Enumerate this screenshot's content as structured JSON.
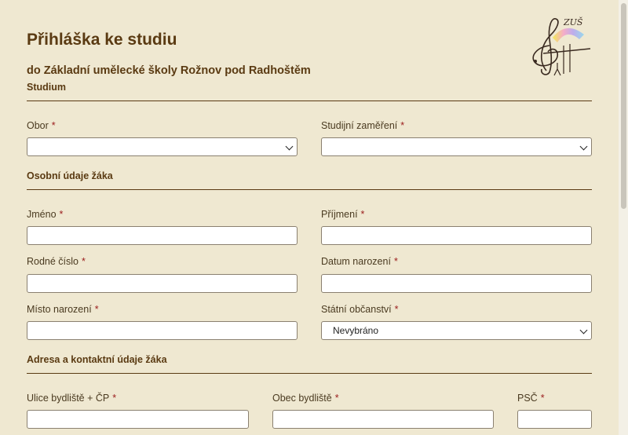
{
  "header": {
    "title": "Přihláška ke studiu",
    "subtitle": "do Základní umělecké školy Rožnov pod Radhoštěm",
    "logo_text": "ZUŠ"
  },
  "sections": {
    "studium": "Studium",
    "osobni": "Osobní údaje žáka",
    "adresa": "Adresa a kontaktní údaje žáka"
  },
  "fields": {
    "obor": {
      "label": "Obor",
      "required": "*",
      "value": ""
    },
    "zamereni": {
      "label": "Studijní zaměření",
      "required": "*",
      "value": ""
    },
    "jmeno": {
      "label": "Jméno",
      "required": "*"
    },
    "prijmeni": {
      "label": "Příjmení",
      "required": "*"
    },
    "rodne_cislo": {
      "label": "Rodné číslo",
      "required": "*"
    },
    "datum_narozeni": {
      "label": "Datum narození",
      "required": "*"
    },
    "misto_narozeni": {
      "label": "Místo narození",
      "required": "*"
    },
    "obcanstvi": {
      "label": "Státní občanství",
      "required": "*",
      "value": "Nevybráno"
    },
    "ulice": {
      "label": "Ulice bydliště + ČP",
      "required": "*"
    },
    "obec": {
      "label": "Obec bydliště",
      "required": "*"
    },
    "psc": {
      "label": "PSČ",
      "required": "*"
    }
  },
  "colors": {
    "background": "#efe8d1",
    "heading": "#5a3a12",
    "required": "#9a1b1b"
  }
}
